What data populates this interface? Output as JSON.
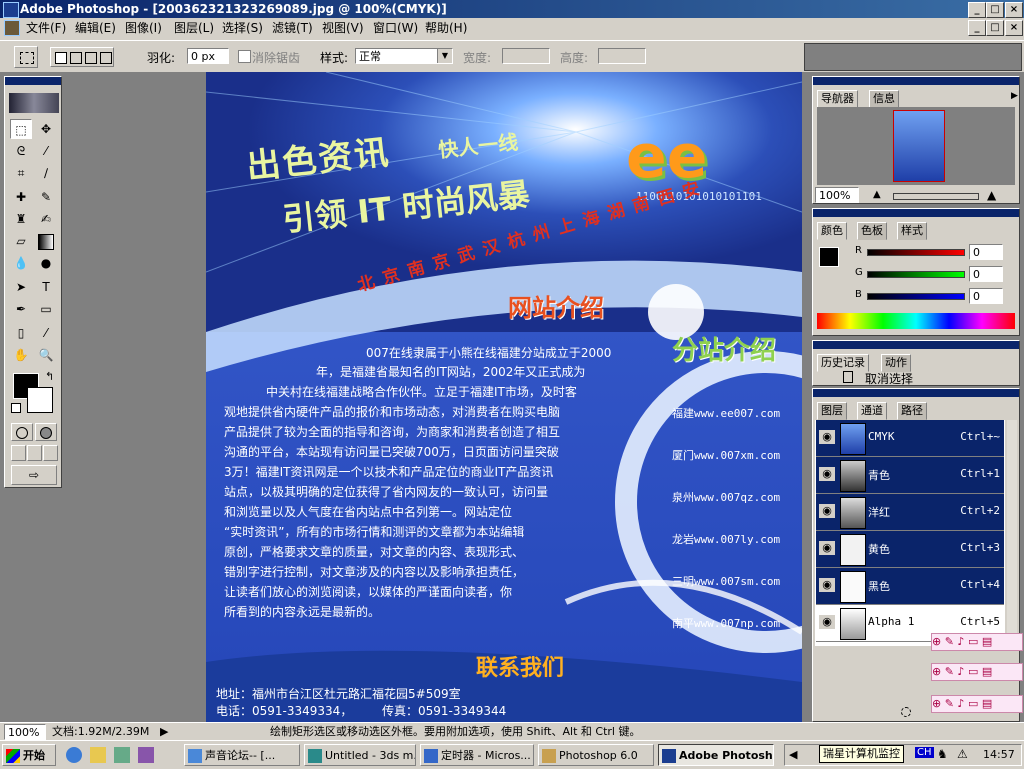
{
  "window": {
    "title": "Adobe Photoshop - [200362321323269089.jpg @ 100%(CMYK)]",
    "min": "_",
    "max": "□",
    "close": "×"
  },
  "menu": [
    "文件(F)",
    "编辑(E)",
    "图像(I)",
    "图层(L)",
    "选择(S)",
    "滤镜(T)",
    "视图(V)",
    "窗口(W)",
    "帮助(H)"
  ],
  "options": {
    "feather_label": "羽化:",
    "feather_value": "0 px",
    "antialias_label": "消除锯齿",
    "style_label": "样式:",
    "style_value": "正常",
    "width_label": "宽度:",
    "height_label": "高度:"
  },
  "canvas": {
    "headline1": "出色资讯",
    "headline1b": "快人一线",
    "headline2": "引领 IT 时尚风暴",
    "logo": "ee",
    "binary": "1100110101010101101",
    "cities": "北京南京武汉杭州上海湖南西安",
    "intro_heading": "网站介绍",
    "branch_heading": "分站介绍",
    "intro_lines": [
      "007在线隶属于小熊在线福建分站成立于2000",
      "年，是福建省最知名的IT网站，2002年又正式成为",
      "中关村在线福建战略合作伙伴。立足于福建IT市场，及时客",
      "观地提供省内硬件产品的报价和市场动态，对消费者在购买电脑",
      "产品提供了较为全面的指导和咨询，为商家和消费者创造了相互",
      "沟通的平台，本站现有访问量已突破700万，日页面访问量突破",
      "3万！福建IT资讯网是一个以技术和产品定位的商业IT产品资讯",
      "站点，以极其明确的定位获得了省内网友的一致认可，访问量",
      "和浏览量以及人气度在省内站点中名列第一。网站定位",
      "“实时资讯”，所有的市场行情和测评的文章都为本站编辑",
      "原创，严格要求文章的质量，对文章的内容、表现形式、",
      "错别字进行控制，对文章涉及的内容以及影响承担责任，",
      "让读者们放心的浏览阅读，以媒体的严谨面向读者，你",
      "所看到的内容永远是最新的。"
    ],
    "branches": [
      "福建www.ee007.com",
      "厦门www.007xm.com",
      "泉州www.007qz.com",
      "龙岩www.007ly.com",
      "三明www.007sm.com",
      "南平www.007np.com"
    ],
    "contact_heading": "联系我们",
    "address": "地址：福州市台江区杜元路汇福花园5#509室",
    "phone": "电话：0591-3349334，",
    "fax": "传真：0591-3349344"
  },
  "navigator": {
    "tabs": [
      "导航器",
      "信息"
    ],
    "zoom": "100%"
  },
  "color": {
    "tabs": [
      "颜色",
      "色板",
      "样式"
    ],
    "r": "0",
    "g": "0",
    "b": "0",
    "r_label": "R",
    "g_label": "G",
    "b_label": "B"
  },
  "history": {
    "tabs": [
      "历史记录",
      "动作"
    ],
    "item": "取消选择"
  },
  "channels": {
    "tabs": [
      "图层",
      "通道",
      "路径"
    ],
    "rows": [
      {
        "name": "CMYK",
        "shortcut": "Ctrl+~"
      },
      {
        "name": "青色",
        "shortcut": "Ctrl+1"
      },
      {
        "name": "洋红",
        "shortcut": "Ctrl+2"
      },
      {
        "name": "黄色",
        "shortcut": "Ctrl+3"
      },
      {
        "name": "黑色",
        "shortcut": "Ctrl+4"
      },
      {
        "name": "Alpha 1",
        "shortcut": "Ctrl+5"
      }
    ]
  },
  "status": {
    "zoom": "100%",
    "doc": "文档:1.92M/2.39M",
    "hint": "绘制矩形选区或移动选区外框。要用附加选项，使用 Shift、Alt 和 Ctrl 键。"
  },
  "taskbar": {
    "start": "开始",
    "tasks": [
      "声音论坛-- [...",
      "Untitled - 3ds m...",
      "定时器 - Micros...",
      "Photoshop 6.0",
      "Adobe Photosho..."
    ],
    "tray_label": "瑞星计算机监控",
    "tray_ime": "CH",
    "clock": "14:57"
  }
}
